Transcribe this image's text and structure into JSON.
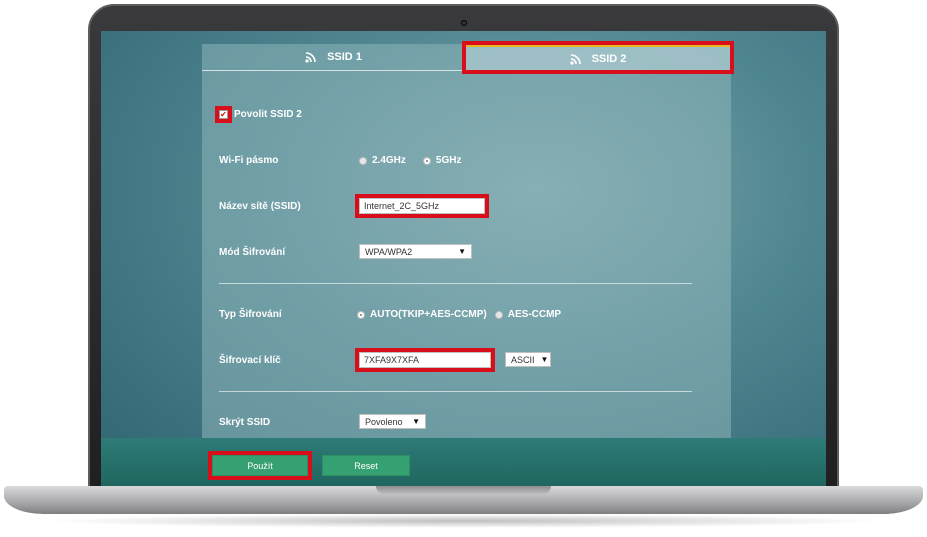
{
  "tabs": [
    {
      "label": "SSID 1",
      "icon": "wifi-icon"
    },
    {
      "label": "SSID 2",
      "icon": "wifi-icon"
    }
  ],
  "enable": {
    "label": "Povolit SSID 2",
    "checked": true
  },
  "band": {
    "label": "Wi-Fi pásmo",
    "options": [
      "2.4GHz",
      "5GHz"
    ],
    "selected": "5GHz"
  },
  "ssid": {
    "label": "Název sítě (SSID)",
    "value": "Internet_2C_5GHz"
  },
  "mode": {
    "label": "Mód Šifrování",
    "value": "WPA/WPA2"
  },
  "enc_type": {
    "label": "Typ Šifrování",
    "options": [
      "AUTO(TKIP+AES-CCMP)",
      "AES-CCMP"
    ],
    "selected": "AUTO(TKIP+AES-CCMP)"
  },
  "key": {
    "label": "Šifrovací klíč",
    "value": "7XFA9X7XFA",
    "format": "ASCII"
  },
  "hide": {
    "label": "Skrýt SSID",
    "value": "Povoleno"
  },
  "buttons": {
    "apply": "Použít",
    "reset": "Reset"
  },
  "colors": {
    "highlight": "#d80f1b",
    "button": "#35a071",
    "tab_accent": "#e8b820"
  }
}
